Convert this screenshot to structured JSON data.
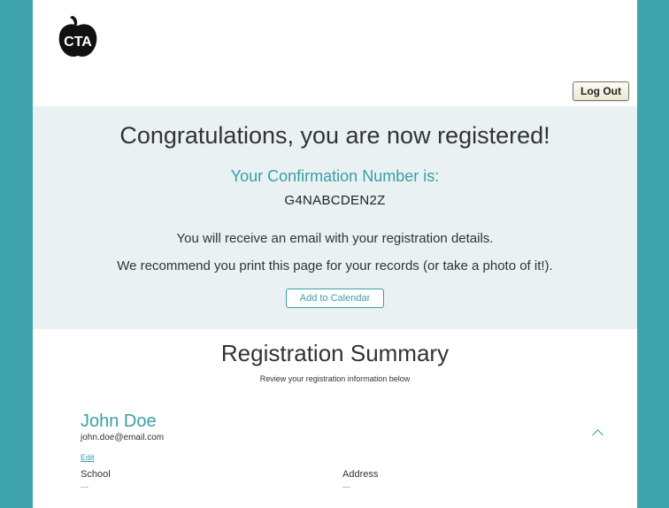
{
  "header": {
    "logo_text": "CTA",
    "logout_label": "Log Out"
  },
  "confirmation": {
    "headline": "Congratulations, you are now registered!",
    "number_label": "Your Confirmation Number is:",
    "number": "G4NABCDEN2Z",
    "email_message": "You will receive an email with your registration details.",
    "print_message": "We recommend you print this page for your records (or take a photo of it!).",
    "calendar_label": "Add to Calendar"
  },
  "summary": {
    "title": "Registration Summary",
    "subtitle": "Review your registration information below",
    "person": {
      "name": "John Doe",
      "email": "john.doe@email.com",
      "edit_label": "Edit"
    },
    "fields": [
      {
        "label": "School",
        "value": "---"
      },
      {
        "label": "Address",
        "value": "---"
      }
    ]
  },
  "colors": {
    "accent": "#3a9ea8",
    "side_bg": "#3fa3ae",
    "banner_bg": "#e9f1f3"
  }
}
